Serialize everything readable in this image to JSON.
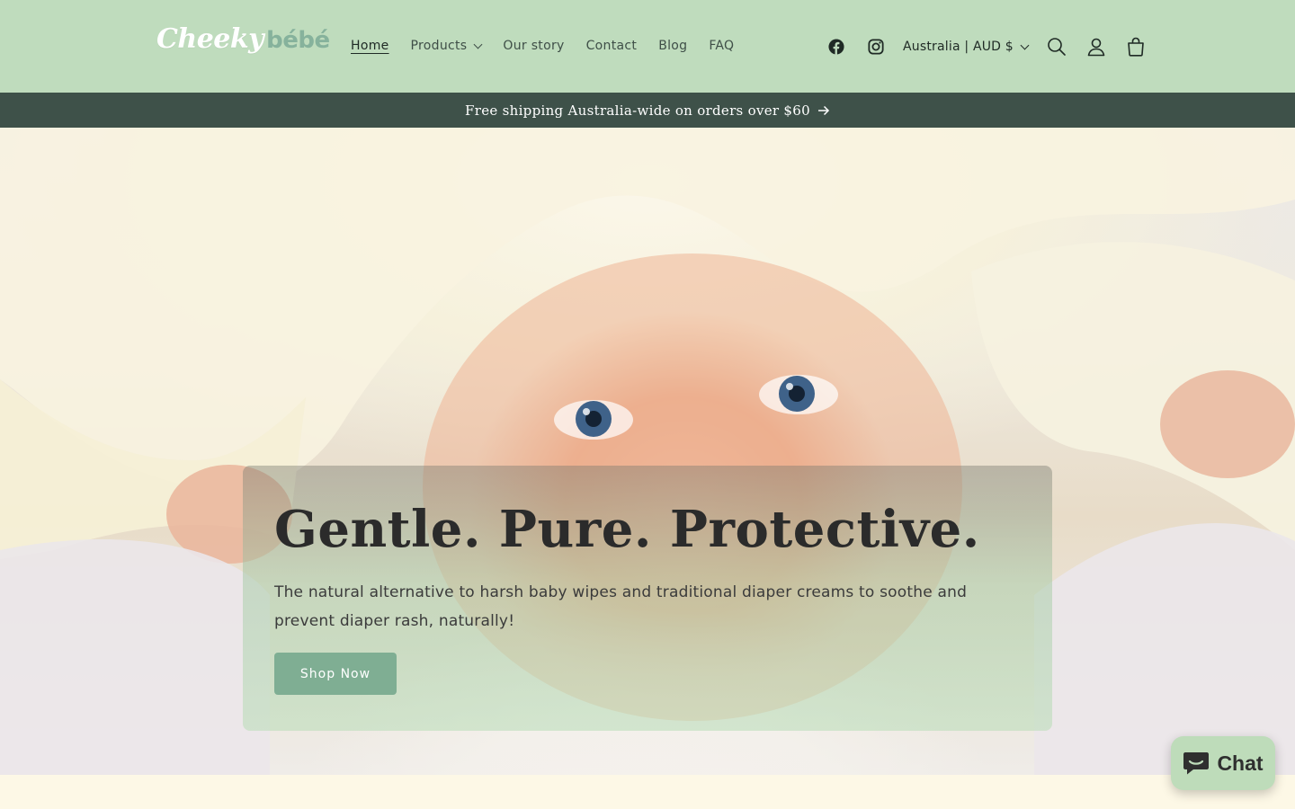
{
  "header": {
    "logo": {
      "part1": "Cheeky",
      "part2": "bébé"
    },
    "nav": [
      {
        "label": "Home",
        "active": true
      },
      {
        "label": "Products",
        "has_dropdown": true
      },
      {
        "label": "Our story"
      },
      {
        "label": "Contact"
      },
      {
        "label": "Blog"
      },
      {
        "label": "FAQ"
      }
    ],
    "locale": "Australia | AUD $",
    "icons": [
      "facebook-icon",
      "instagram-icon",
      "search-icon",
      "account-icon",
      "cart-icon"
    ]
  },
  "announcement": {
    "text": "Free shipping Australia-wide on orders over $60"
  },
  "hero": {
    "title": "Gentle. Pure. Protective.",
    "subtitle": "The natural alternative to harsh baby wipes and traditional diaper creams to soothe and prevent diaper rash, naturally!",
    "cta": "Shop Now"
  },
  "chat": {
    "label": "Chat"
  },
  "colors": {
    "header_bg": "#bfdcbd",
    "announcement_bg": "#3e5149",
    "button_bg": "#7fae93",
    "chat_bg": "#bedcba",
    "footer_strip": "#fdf8e6"
  }
}
